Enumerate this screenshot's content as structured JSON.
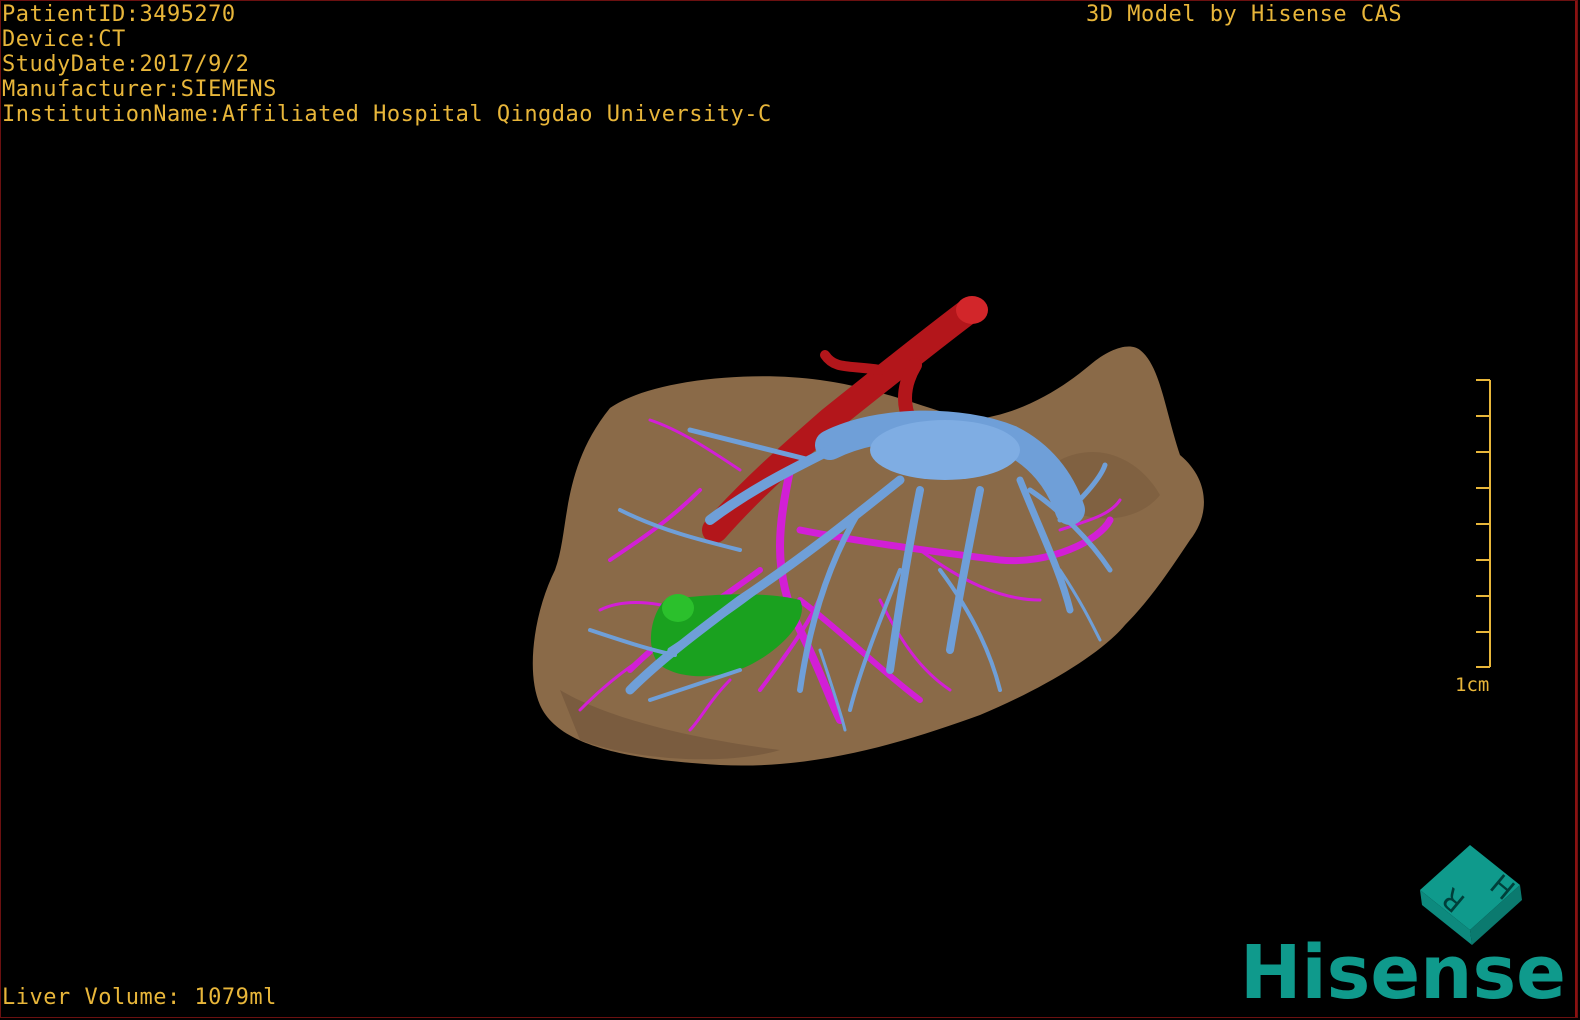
{
  "header": {
    "patient_id": "PatientID:3495270",
    "device": "Device:CT",
    "study_date": "StudyDate:2017/9/2",
    "manufacturer": "Manufacturer:SIEMENS",
    "institution": "InstitutionName:Affiliated Hospital Qingdao University-C"
  },
  "title": "3D Model by Hisense CAS",
  "footer": {
    "liver_volume": "Liver Volume: 1079ml"
  },
  "scale_bar": {
    "label": "1cm",
    "ticks": 9
  },
  "orientation_cube": {
    "letters": [
      "H",
      "R"
    ]
  },
  "logo": {
    "text": "Hisense"
  },
  "colors": {
    "text": "#e8b63a",
    "liver": "#8a6a48",
    "artery": "#b3161b",
    "portal_vein": "#6f9fd8",
    "hepatic_vein": "#d21fd6",
    "gallbladder": "#1aa11f",
    "brand": "#0f9a8c"
  }
}
